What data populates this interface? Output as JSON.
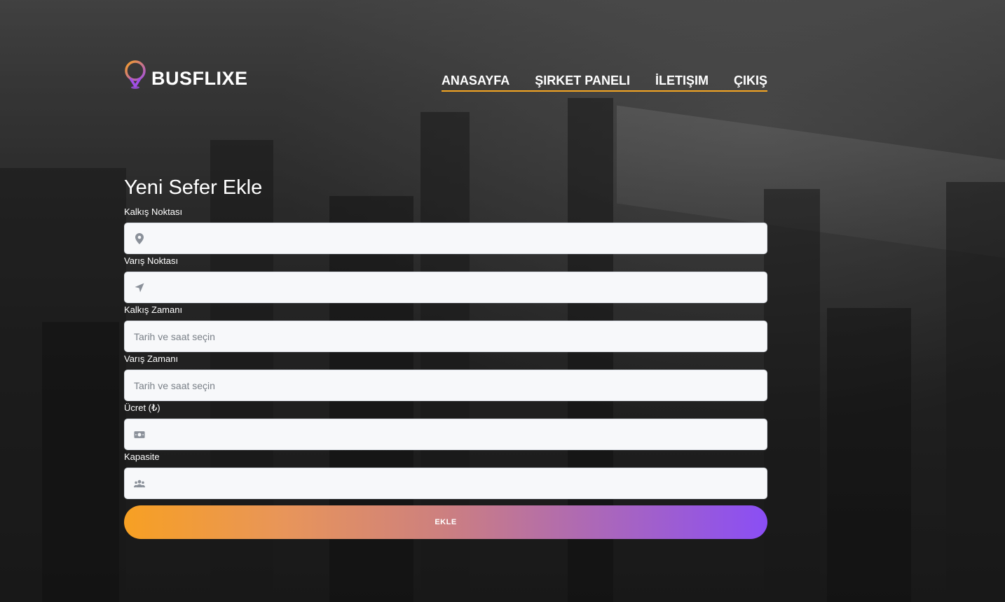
{
  "brand": {
    "name": "BUSFLIXE"
  },
  "nav": {
    "items": [
      {
        "label": "ANASAYFA"
      },
      {
        "label": "ŞIRKET PANELI"
      },
      {
        "label": "İLETIŞIM"
      },
      {
        "label": "ÇIKIŞ"
      }
    ]
  },
  "page": {
    "title": "Yeni Sefer Ekle"
  },
  "form": {
    "fields": [
      {
        "label": "Kalkış Noktası",
        "placeholder": "",
        "icon": "map-marker-icon"
      },
      {
        "label": "Varış Noktası",
        "placeholder": "",
        "icon": "location-arrow-icon"
      },
      {
        "label": "Kalkış Zamanı",
        "placeholder": "Tarih ve saat seçin",
        "icon": ""
      },
      {
        "label": "Varış Zamanı",
        "placeholder": "Tarih ve saat seçin",
        "icon": ""
      },
      {
        "label": "Ücret (₺)",
        "placeholder": "",
        "icon": "money-bill-icon"
      },
      {
        "label": "Kapasite",
        "placeholder": "",
        "icon": "users-icon"
      }
    ],
    "submit_label": "EKLE"
  },
  "colors": {
    "accent": "#f5a623",
    "gradient_start": "#f7a023",
    "gradient_end": "#8a4ef5",
    "logo_pin": "#a14ee6"
  }
}
